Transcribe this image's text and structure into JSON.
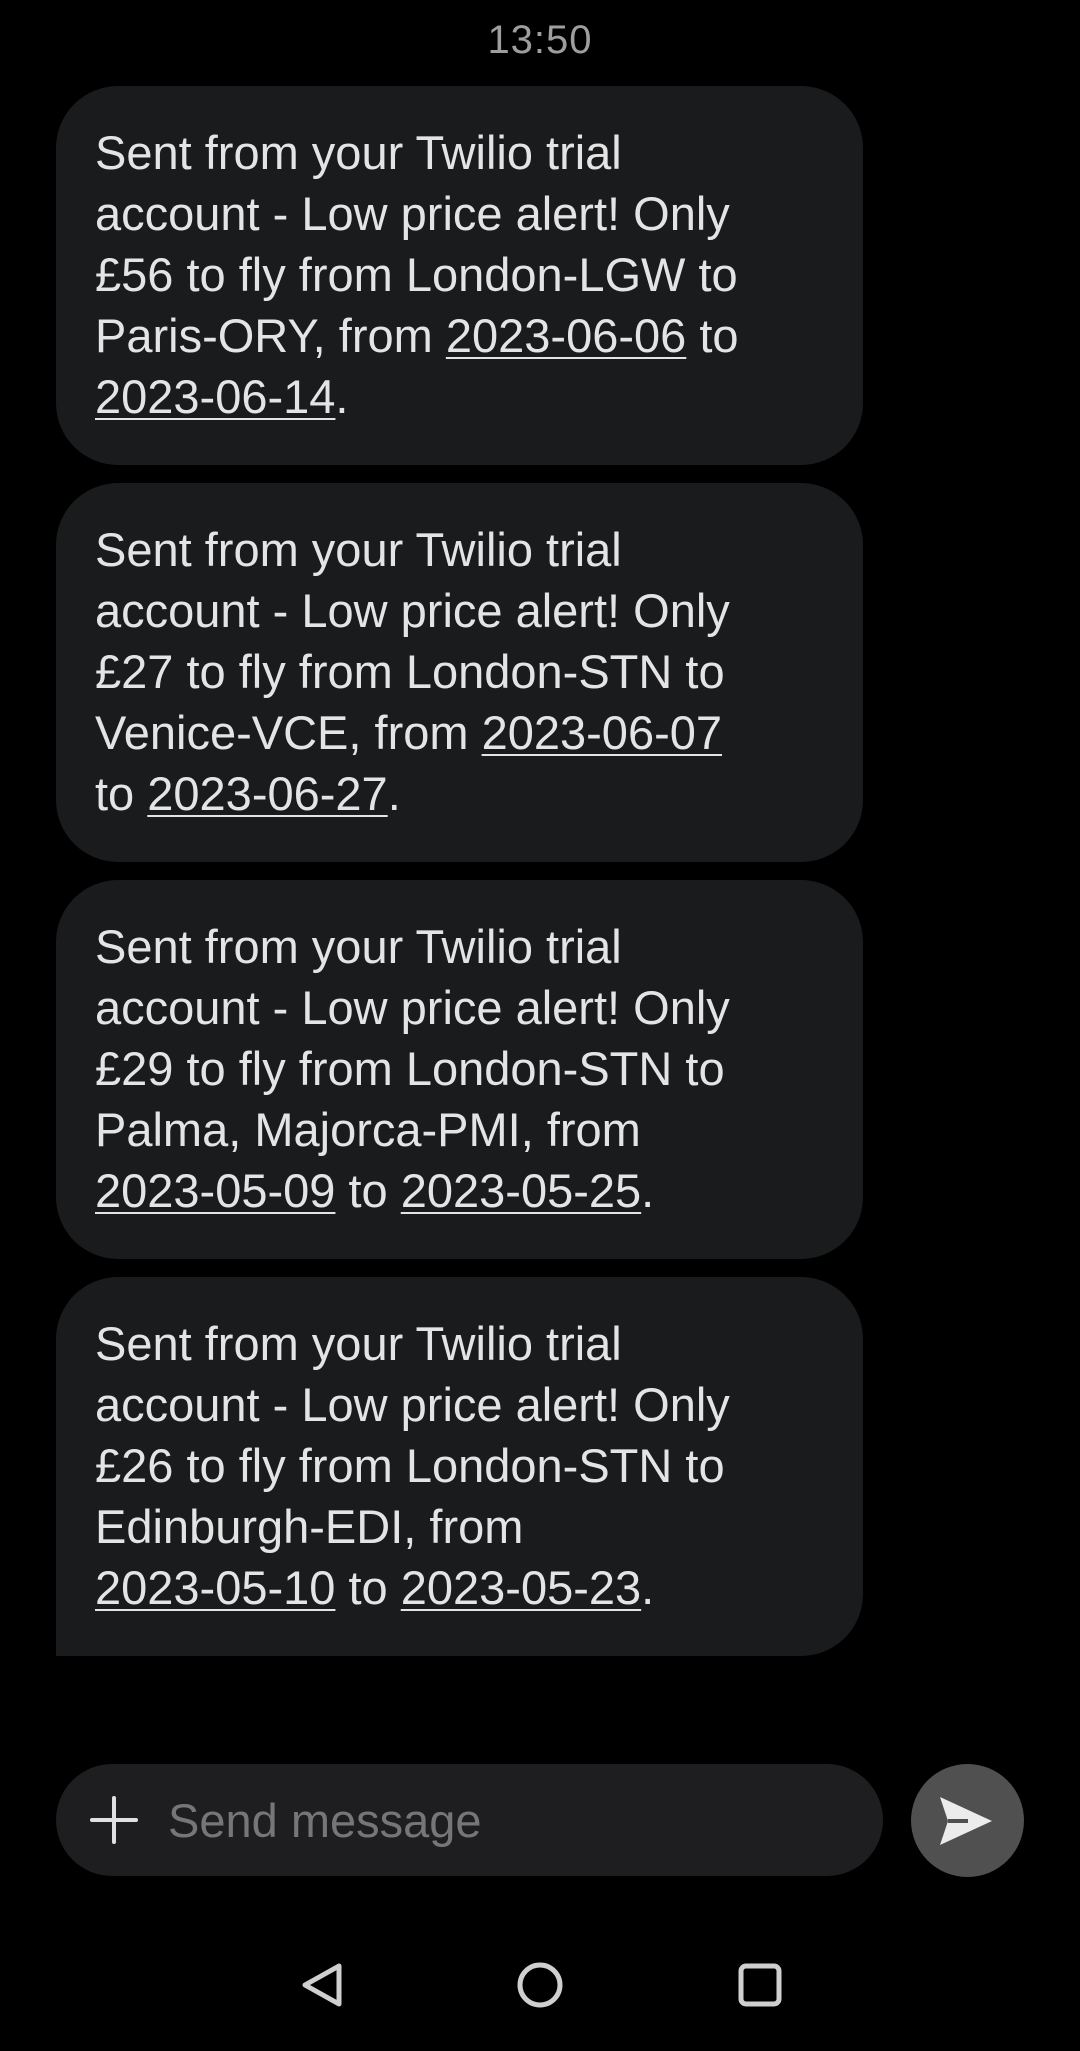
{
  "status": {
    "time": "13:50"
  },
  "messages": [
    {
      "lines": [
        [
          {
            "t": "Sent from your Twilio trial"
          }
        ],
        [
          {
            "t": "account - Low price alert! Only"
          }
        ],
        [
          {
            "t": "£56 to fly from London-LGW to"
          }
        ],
        [
          {
            "t": "Paris-ORY, from "
          },
          {
            "t": "2023-06-06",
            "link": true
          },
          {
            "t": " to"
          }
        ],
        [
          {
            "t": "2023-06-14",
            "link": true
          },
          {
            "t": "."
          }
        ]
      ]
    },
    {
      "lines": [
        [
          {
            "t": "Sent from your Twilio trial"
          }
        ],
        [
          {
            "t": "account - Low price alert! Only"
          }
        ],
        [
          {
            "t": "£27 to fly from London-STN to"
          }
        ],
        [
          {
            "t": "Venice-VCE, from "
          },
          {
            "t": "2023-06-07",
            "link": true
          }
        ],
        [
          {
            "t": "to "
          },
          {
            "t": "2023-06-27",
            "link": true
          },
          {
            "t": "."
          }
        ]
      ]
    },
    {
      "lines": [
        [
          {
            "t": "Sent from your Twilio trial"
          }
        ],
        [
          {
            "t": "account - Low price alert! Only"
          }
        ],
        [
          {
            "t": "£29 to fly from London-STN to"
          }
        ],
        [
          {
            "t": "Palma, Majorca-PMI, from"
          }
        ],
        [
          {
            "t": "2023-05-09",
            "link": true
          },
          {
            "t": " to "
          },
          {
            "t": "2023-05-25",
            "link": true
          },
          {
            "t": "."
          }
        ]
      ]
    },
    {
      "lines": [
        [
          {
            "t": "Sent from your Twilio trial"
          }
        ],
        [
          {
            "t": "account - Low price alert! Only"
          }
        ],
        [
          {
            "t": "£26 to fly from London-STN to"
          }
        ],
        [
          {
            "t": "Edinburgh-EDI, from"
          }
        ],
        [
          {
            "t": "2023-05-10",
            "link": true
          },
          {
            "t": " to "
          },
          {
            "t": "2023-05-23",
            "link": true
          },
          {
            "t": "."
          }
        ]
      ]
    }
  ],
  "composer": {
    "placeholder": "Send message",
    "value": "",
    "attach_icon": "plus-icon",
    "send_icon": "send-icon"
  },
  "navbar": {
    "icons": [
      "back-triangle-icon",
      "home-circle-icon",
      "recents-square-icon"
    ]
  },
  "colors": {
    "background": "#000000",
    "bubble": "#1a1b1d",
    "text": "#e4e4e4",
    "timestamp": "#9e9e9e",
    "placeholder": "#767676",
    "send_button": "#505050"
  }
}
